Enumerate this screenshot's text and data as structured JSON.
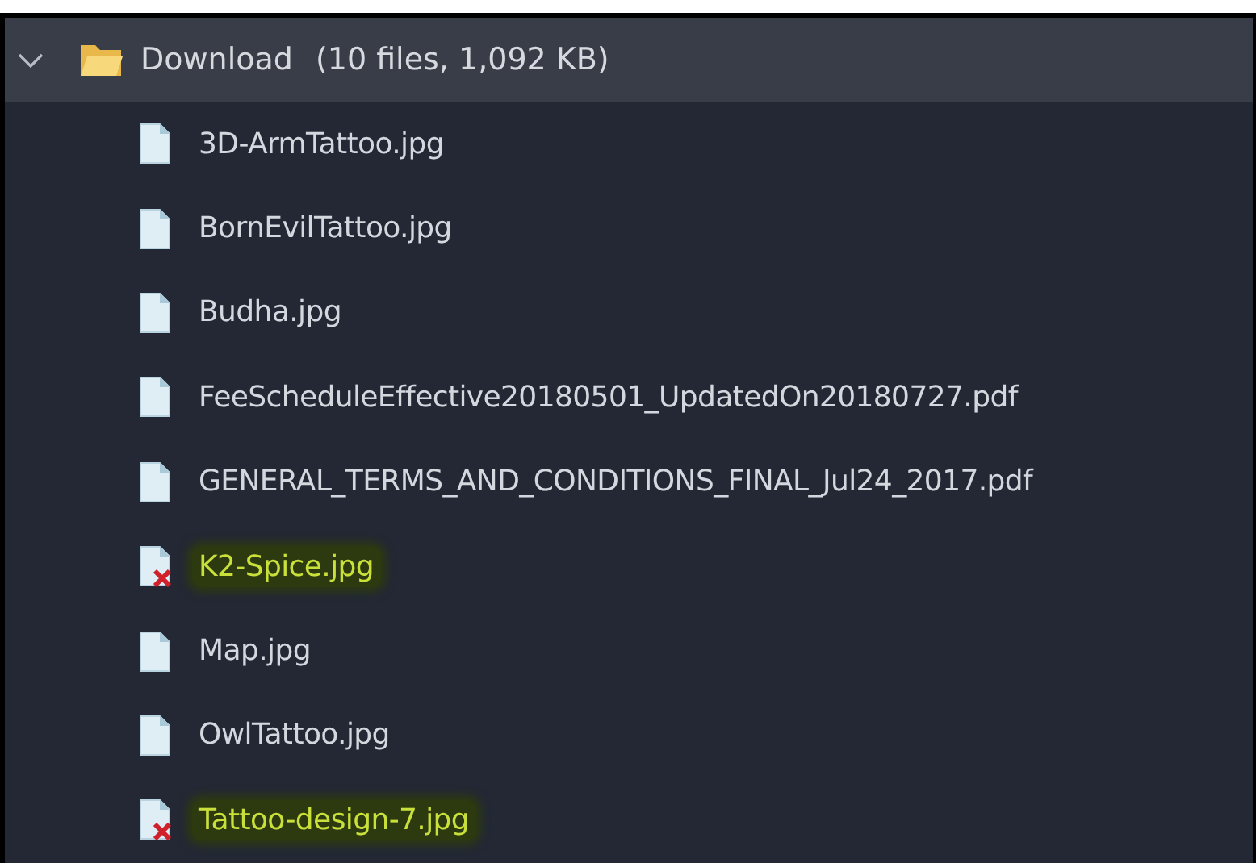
{
  "folder": {
    "name": "Download",
    "summary": "(10 files, 1,092 KB)",
    "expanded": true
  },
  "files": [
    {
      "name": "3D-ArmTattoo.jpg",
      "kind": "file",
      "flagged": false
    },
    {
      "name": "BornEvilTattoo.jpg",
      "kind": "file",
      "flagged": false
    },
    {
      "name": "Budha.jpg",
      "kind": "file",
      "flagged": false
    },
    {
      "name": "FeeScheduleEffective20180501_UpdatedOn20180727.pdf",
      "kind": "file",
      "flagged": false
    },
    {
      "name": "GENERAL_TERMS_AND_CONDITIONS_FINAL_Jul24_2017.pdf",
      "kind": "file",
      "flagged": false
    },
    {
      "name": "K2-Spice.jpg",
      "kind": "broken",
      "flagged": true
    },
    {
      "name": "Map.jpg",
      "kind": "file",
      "flagged": false
    },
    {
      "name": "OwlTattoo.jpg",
      "kind": "file",
      "flagged": false
    },
    {
      "name": "Tattoo-design-7.jpg",
      "kind": "broken",
      "flagged": true
    }
  ]
}
